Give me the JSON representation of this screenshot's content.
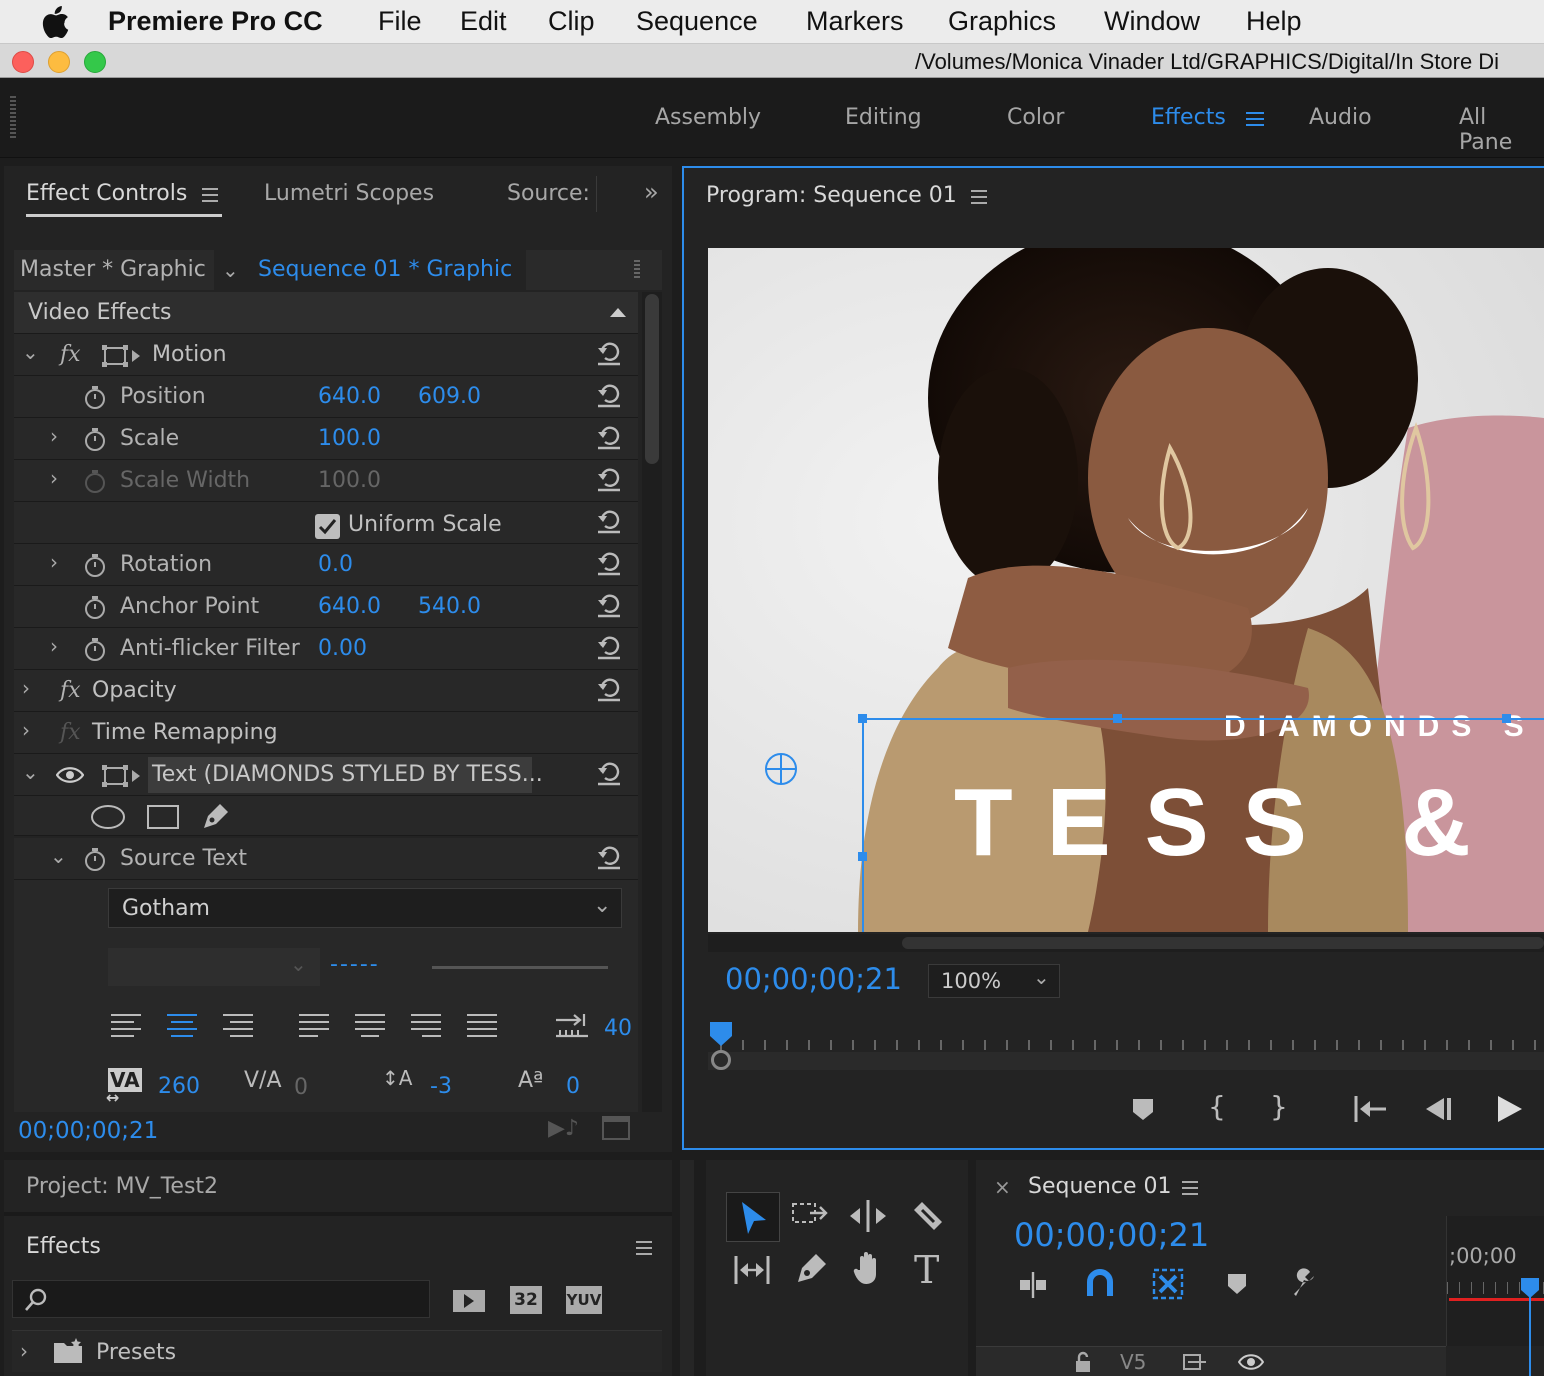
{
  "menubar": {
    "app_name": "Premiere Pro CC",
    "items": [
      "File",
      "Edit",
      "Clip",
      "Sequence",
      "Markers",
      "Graphics",
      "Window",
      "Help"
    ]
  },
  "titlebar": {
    "path": "/Volumes/Monica Vinader Ltd/GRAPHICS/Digital/In Store Di"
  },
  "workspaces": {
    "items": [
      "Assembly",
      "Editing",
      "Color",
      "Effects",
      "Audio",
      "All Pane"
    ],
    "active": "Effects"
  },
  "effect_controls": {
    "tabs": [
      "Effect Controls",
      "Lumetri Scopes",
      "Source:"
    ],
    "master_clip": "Master * Graphic",
    "sequence_clip": "Sequence 01 * Graphic",
    "section_title": "Video Effects",
    "motion_label": "Motion",
    "props": {
      "position": {
        "label": "Position",
        "x": "640.0",
        "y": "609.0"
      },
      "scale": {
        "label": "Scale",
        "value": "100.0"
      },
      "scale_width": {
        "label": "Scale Width",
        "value": "100.0"
      },
      "uniform_scale": {
        "label": "Uniform Scale",
        "checked": true
      },
      "rotation": {
        "label": "Rotation",
        "value": "0.0"
      },
      "anchor_point": {
        "label": "Anchor Point",
        "x": "640.0",
        "y": "540.0"
      },
      "anti_flicker": {
        "label": "Anti-flicker Filter",
        "value": "0.00"
      }
    },
    "opacity_label": "Opacity",
    "time_remap_label": "Time Remapping",
    "text_layer_label": "Text (DIAMONDS STYLED BY TESS...",
    "source_text_label": "Source Text",
    "font_name": "Gotham",
    "font_style_value": "-----",
    "tab_stops_value": "40",
    "kerning_value": "260",
    "tracking_value": "0",
    "leading_value": "-3",
    "baseline_value": "0",
    "timecode": "00;00;00;21"
  },
  "program_monitor": {
    "title": "Program: Sequence 01",
    "timecode": "00;00;00;21",
    "zoom": "100%",
    "overlay_text_line1": "DIAMONDS S",
    "overlay_text_line2": "TESS &"
  },
  "project_panel": {
    "title": "Project: MV_Test2",
    "effects_label": "Effects",
    "search_placeholder": "",
    "badge_32": "32",
    "badge_yuv": "YUV",
    "presets_label": "Presets"
  },
  "timeline": {
    "title": "Sequence 01",
    "timecode": "00;00;00;21",
    "ruler_label": ";00;00",
    "track_label": "V5"
  },
  "colors": {
    "accent_blue": "#2d8ceb",
    "panel_bg": "#232323",
    "playhead_red": "#e02020"
  }
}
